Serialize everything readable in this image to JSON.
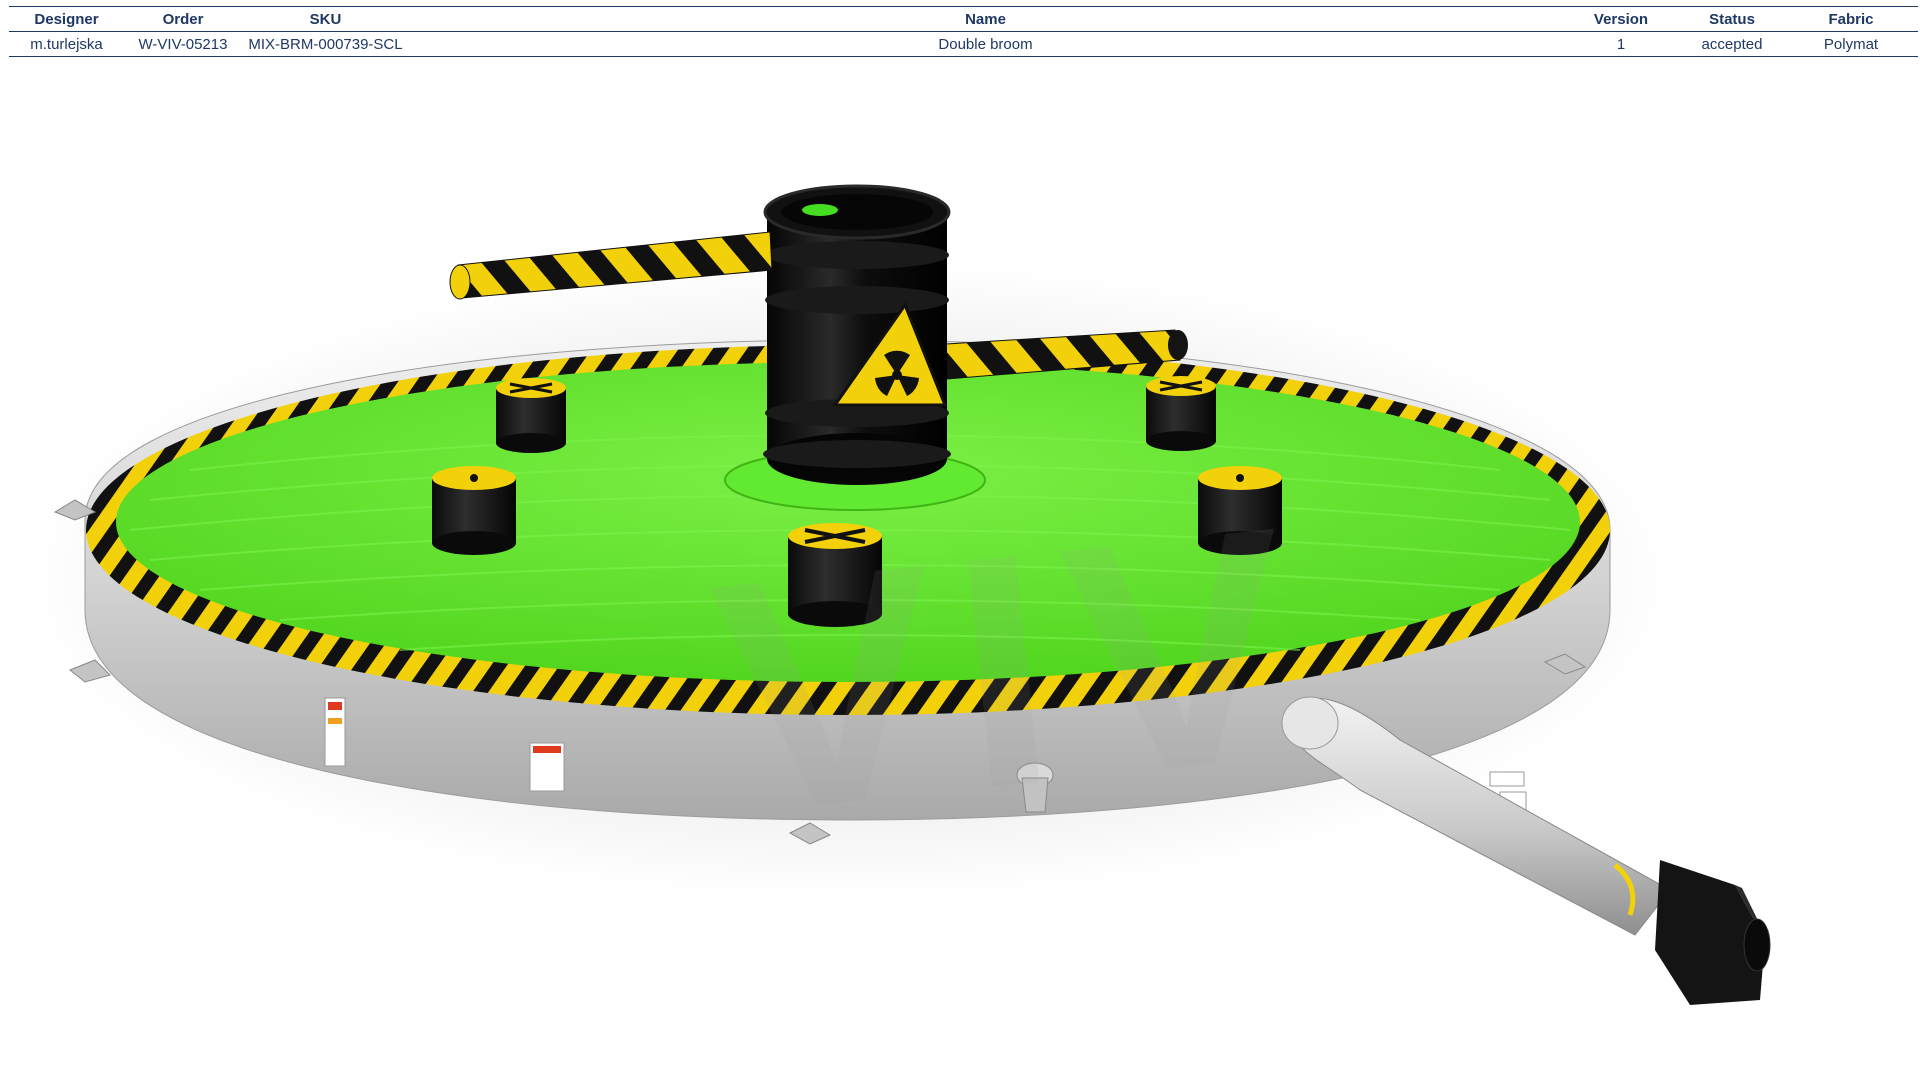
{
  "table": {
    "headers": [
      "Designer",
      "Order",
      "SKU",
      "Name",
      "Version",
      "Status",
      "Fabric"
    ],
    "row": [
      "m.turlejska",
      "W-VIV-05213",
      "MIX-BRM-000739-SCL",
      "Double broom",
      "1",
      "accepted",
      "Polymat"
    ]
  },
  "product": {
    "watermark_text": "VIV",
    "colors": {
      "mat_green": "#59e626",
      "hazard_yellow": "#f2d10a",
      "hazard_black": "#111111",
      "wall_gray": "#cfcfcf",
      "blower_black": "#141414"
    }
  }
}
